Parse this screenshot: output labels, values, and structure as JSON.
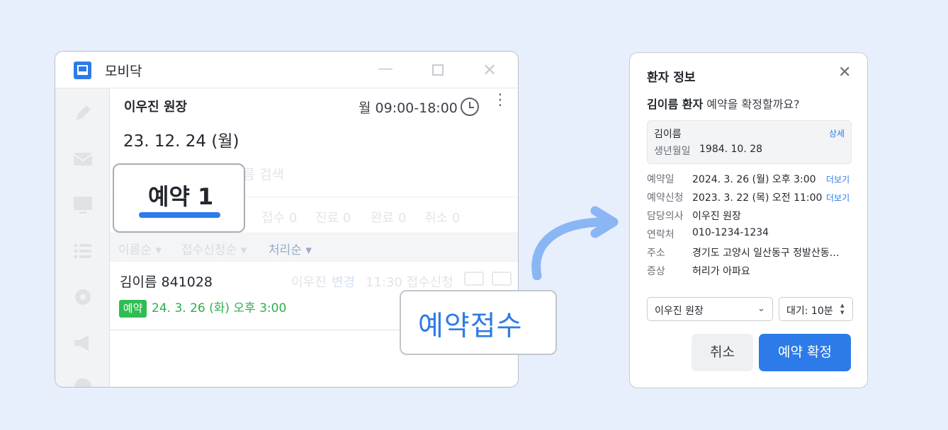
{
  "app": {
    "title": "모비닥",
    "doctor_header": "이우진 원장",
    "hours": "월 09:00-18:00",
    "date": "23. 12. 24 (월)",
    "search_placeholder": "이름 검색",
    "tabs": [
      "접수 0",
      "진료 0",
      "완료 0",
      "취소 0"
    ],
    "sorts": [
      "이름순",
      "접수신청순",
      "처리순"
    ],
    "row": {
      "name": "김이름 841028",
      "doctor": "이우진",
      "change": "변경",
      "time": "11:30 접수신청",
      "badge": "예약",
      "reservation": "24. 3. 26 (화) 오후 3:00"
    }
  },
  "callouts": {
    "reservation_count": "예약 1",
    "accept": "예약접수"
  },
  "dialog": {
    "title": "환자 정보",
    "question_bold": "김이름 환자",
    "question_rest": " 예약을 확정할까요?",
    "card": {
      "name": "김이름",
      "detail_link": "상세",
      "birth_label": "생년월일",
      "birth_value": "1984. 10. 28"
    },
    "fields": [
      {
        "label": "예약일",
        "value": "2024. 3. 26 (월) 오후 3:00",
        "more": "더보기"
      },
      {
        "label": "예약신청",
        "value": "2023. 3. 22 (목) 오전 11:00",
        "more": "더보기"
      },
      {
        "label": "담당의사",
        "value": "이우진 원장",
        "more": ""
      },
      {
        "label": "연락처",
        "value": "010-1234-1234",
        "more": ""
      },
      {
        "label": "주소",
        "value": "경기도 고양시 일산동구 정발산동…",
        "more": ""
      },
      {
        "label": "증상",
        "value": "허리가 아파요",
        "more": ""
      }
    ],
    "doctor_select": "이우진 원장",
    "wait_select": "대기: 10분",
    "cancel_label": "취소",
    "confirm_label": "예약 확정"
  },
  "colors": {
    "accent": "#2d7be8",
    "success": "#2fbd52",
    "background": "#e8effc"
  }
}
